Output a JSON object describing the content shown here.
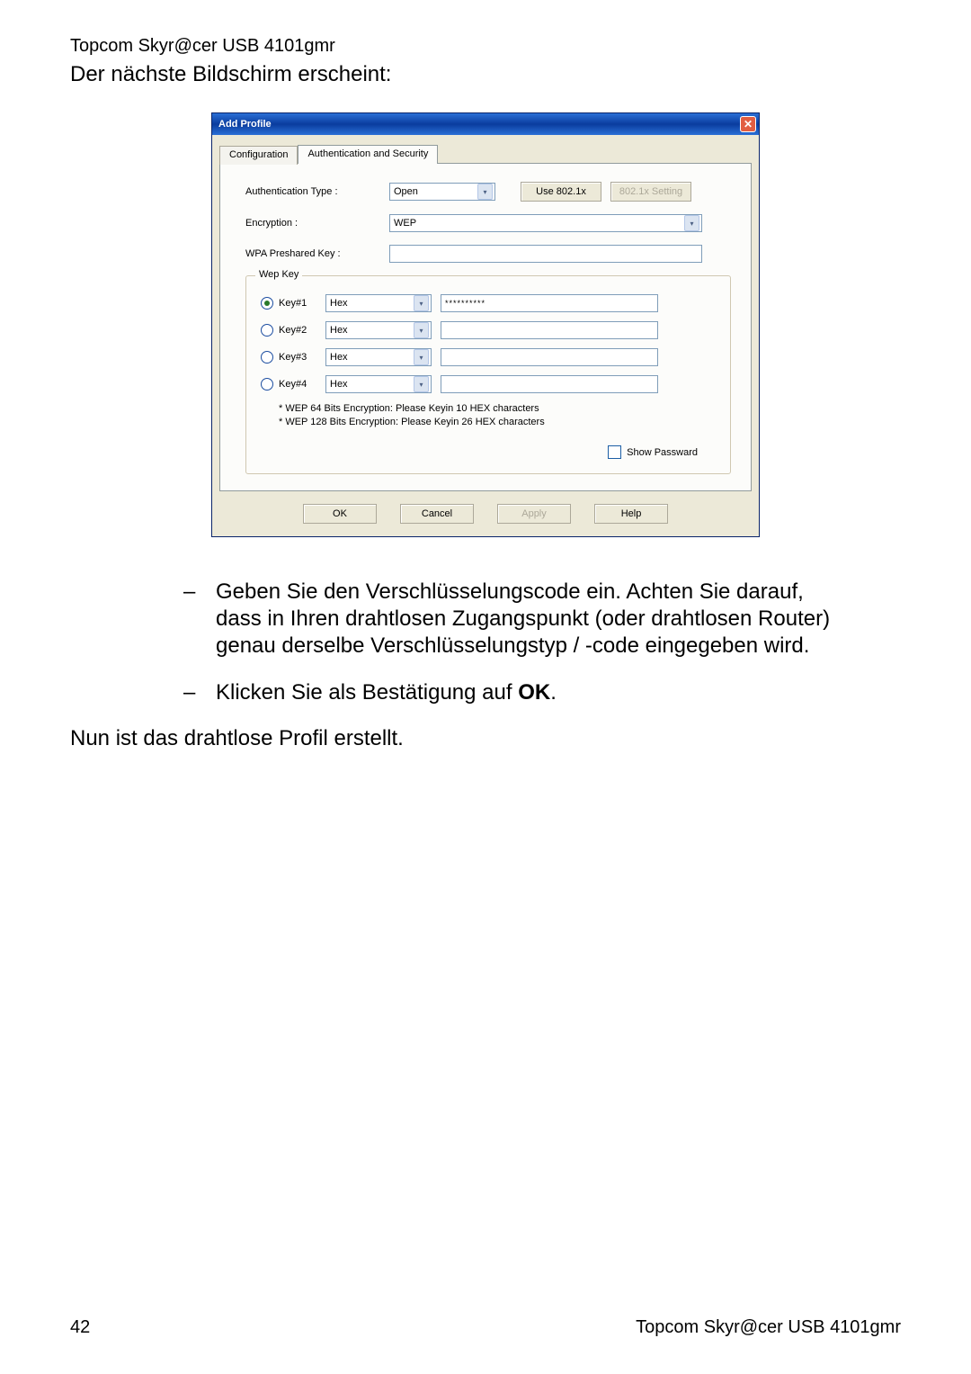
{
  "header_small": "Topcom Skyr@cer USB 4101gmr",
  "lead_text": "Der nächste Bildschirm erscheint:",
  "dialog": {
    "title": "Add Profile",
    "tabs": {
      "config": "Configuration",
      "auth": "Authentication and Security"
    },
    "auth_type_label": "Authentication Type :",
    "auth_type_value": "Open",
    "use8021x_label": "Use 802.1x",
    "setting8021x_label": "802.1x Setting",
    "encryption_label": "Encryption :",
    "encryption_value": "WEP",
    "wpa_label": "WPA Preshared Key :",
    "wpa_value": "",
    "wep_legend": "Wep Key",
    "keys": [
      {
        "label": "Key#1",
        "type": "Hex",
        "value": "**********",
        "selected": true
      },
      {
        "label": "Key#2",
        "type": "Hex",
        "value": "",
        "selected": false
      },
      {
        "label": "Key#3",
        "type": "Hex",
        "value": "",
        "selected": false
      },
      {
        "label": "Key#4",
        "type": "Hex",
        "value": "",
        "selected": false
      }
    ],
    "help1": "* WEP 64 Bits Encryption:   Please Keyin 10 HEX characters",
    "help2": "* WEP 128 Bits Encryption:   Please Keyin 26 HEX characters",
    "show_pw_label": "Show Passward",
    "buttons": {
      "ok": "OK",
      "cancel": "Cancel",
      "apply": "Apply",
      "help": "Help"
    }
  },
  "bullets": [
    "Geben Sie den Verschlüsselungscode ein. Achten Sie darauf, dass in Ihren drahtlosen Zugangspunkt (oder drahtlosen Router) genau derselbe Verschlüsselungstyp / -code eingegeben wird.",
    "Klicken Sie als Bestätigung auf "
  ],
  "ok_bold": "OK",
  "final": "Nun ist das drahtlose Profil erstellt.",
  "page_number": "42",
  "footer_right": "Topcom Skyr@cer USB 4101gmr"
}
